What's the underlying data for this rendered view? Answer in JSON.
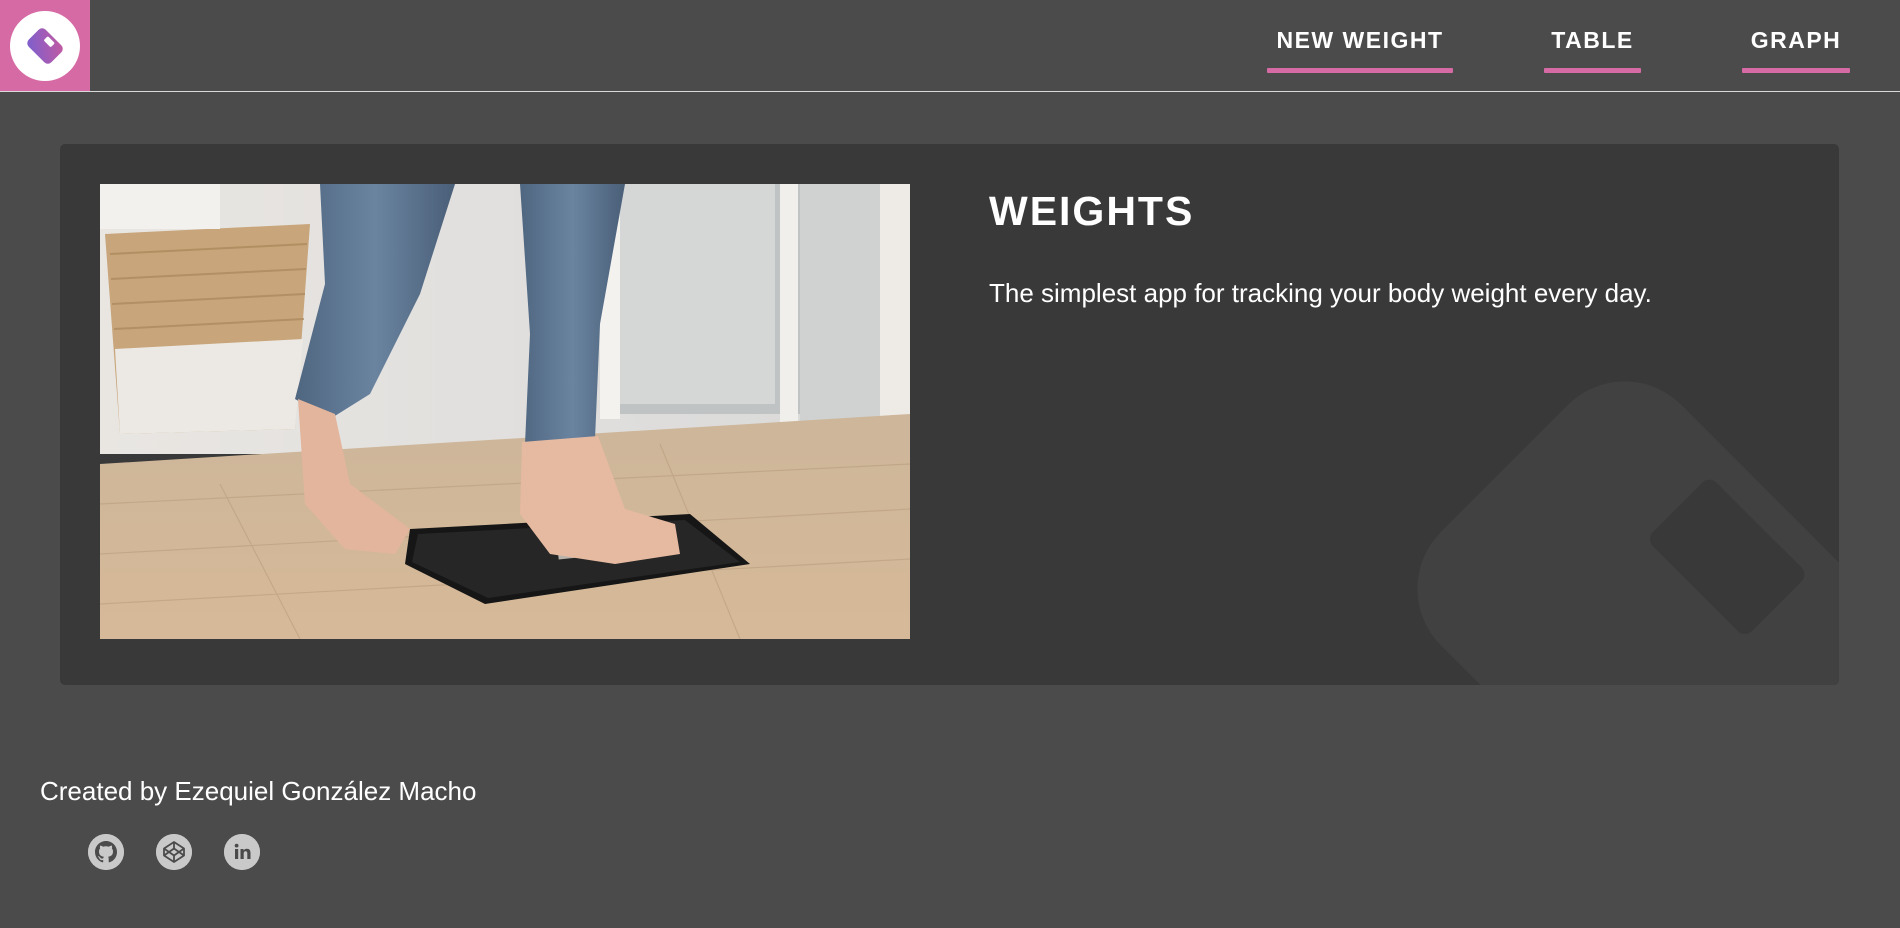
{
  "header": {
    "logo_icon": "app-logo-icon",
    "nav": [
      {
        "label": "NEW WEIGHT"
      },
      {
        "label": "TABLE"
      },
      {
        "label": "GRAPH"
      }
    ]
  },
  "hero": {
    "image_icon": "feet-on-scale-photo",
    "title": "WEIGHTS",
    "description": "The simplest app for tracking your body weight every day."
  },
  "footer": {
    "credit": "Created by Ezequiel González Macho",
    "socials": [
      {
        "icon": "github-icon"
      },
      {
        "icon": "codepen-icon"
      },
      {
        "icon": "linkedin-icon"
      }
    ]
  },
  "colors": {
    "accent": "#d66aa4",
    "background": "#4b4b4b",
    "card": "#393939"
  }
}
